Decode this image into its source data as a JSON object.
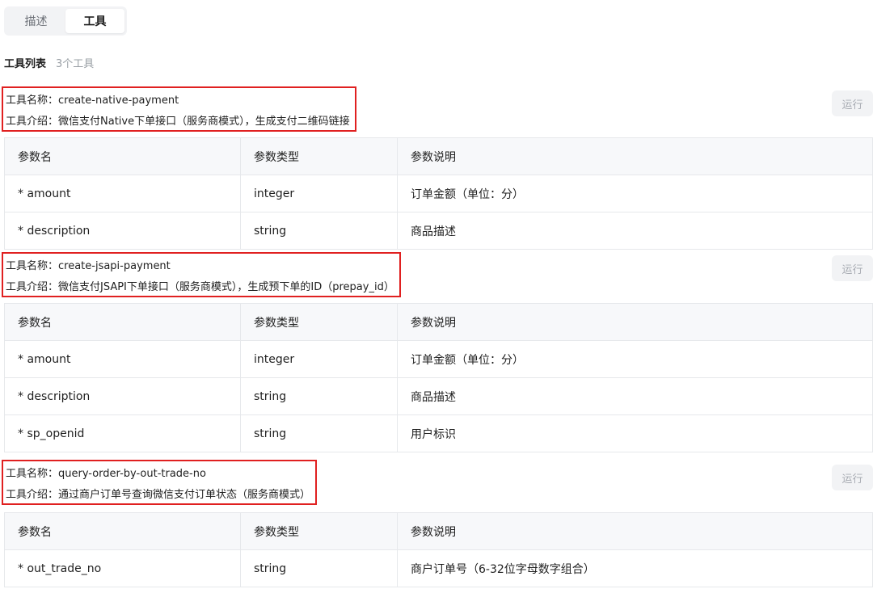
{
  "tabs": [
    {
      "label": "描述",
      "active": false
    },
    {
      "label": "工具",
      "active": true
    }
  ],
  "tool_list": {
    "title": "工具列表",
    "count": "3个工具"
  },
  "columns": [
    "参数名",
    "参数类型",
    "参数说明"
  ],
  "run_label": "运行",
  "tools": [
    {
      "name_line": "工具名称：create-native-payment",
      "desc_line": "工具介绍：微信支付Native下单接口（服务商模式），生成支付二维码链接",
      "params": [
        {
          "name": "* amount",
          "type": "integer",
          "desc": "订单金额（单位：分）"
        },
        {
          "name": "* description",
          "type": "string",
          "desc": "商品描述"
        }
      ]
    },
    {
      "name_line": "工具名称：create-jsapi-payment",
      "desc_line": "工具介绍：微信支付JSAPI下单接口（服务商模式），生成预下单的ID（prepay_id）",
      "params": [
        {
          "name": "* amount",
          "type": "integer",
          "desc": "订单金额（单位：分）"
        },
        {
          "name": "* description",
          "type": "string",
          "desc": "商品描述"
        },
        {
          "name": "* sp_openid",
          "type": "string",
          "desc": "用户标识"
        }
      ]
    },
    {
      "name_line": "工具名称：query-order-by-out-trade-no",
      "desc_line": "工具介绍：通过商户订单号查询微信支付订单状态（服务商模式）",
      "params": [
        {
          "name": "* out_trade_no",
          "type": "string",
          "desc": "商户订单号（6-32位字母数字组合）"
        }
      ]
    }
  ],
  "colors": {
    "highlight_border": "#e02020",
    "table_header_bg": "#f7f8fa",
    "table_border": "#e6e8eb",
    "muted_text": "#9aa0a6"
  }
}
